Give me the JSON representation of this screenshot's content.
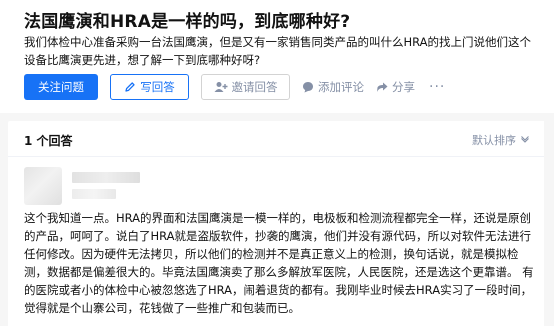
{
  "question": {
    "title": "法国鹰演和HRA是一样的吗，到底哪种好?",
    "description": "我们体检中心准备采购一台法国鹰演，但是又有一家销售同类产品的叫什么HRA的找上门说他们这个设备比鹰演更先进，想了解一下到底哪种好呀?"
  },
  "actions": {
    "follow_label": "关注问题",
    "write_label": "写回答",
    "invite_label": "邀请回答",
    "comment_label": "添加评论",
    "share_label": "分享",
    "more_label": "···"
  },
  "answers": {
    "count_label": "1 个回答",
    "sort_label": "默认排序",
    "items": [
      {
        "text": "这个我知道一点。HRA的界面和法国鹰演是一模一样的，电极板和检测流程都完全一样，还说是原创的产品，呵呵了。说白了HRA就是盗版软件，抄袭的鹰演，他们并没有源代码，所以对软件无法进行任何修改。因为硬件无法拷贝，所以他们的检测并不是真正意义上的检测，换句话说，就是模拟检测，数据都是偏差很大的。毕竟法国鹰演卖了那么多解放军医院，人民医院，还是选这个更靠谱。 有的医院或者小的体检中心被忽悠选了HRA，闹着退货的都有。我刚毕业时候去HRA实习了一段时间，觉得就是个山寨公司，花钱做了一些推广和包装而已。"
      }
    ]
  },
  "colors": {
    "primary": "#1772f6",
    "muted": "#8590a6",
    "background": "#f6f6f6"
  },
  "icons": [
    "pencil-icon",
    "add-user-icon",
    "comment-icon",
    "share-icon",
    "chevron-down-icon"
  ]
}
